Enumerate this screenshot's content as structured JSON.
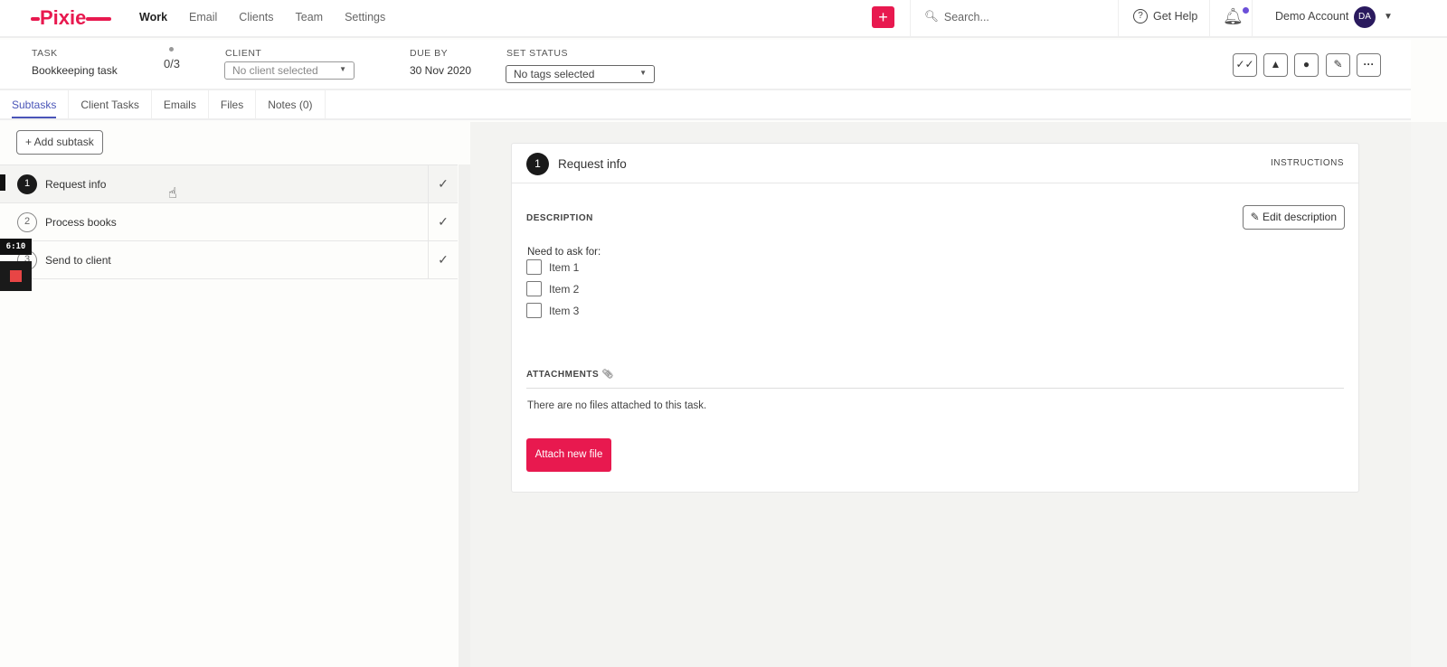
{
  "app": {
    "logo": "Pixie",
    "nav": [
      "Work",
      "Email",
      "Clients",
      "Team",
      "Settings"
    ],
    "search_placeholder": "Search...",
    "help": "Get Help",
    "account": "Demo Account",
    "avatar": "DA",
    "accent": "#e8194f"
  },
  "task": {
    "task_label": "TASK",
    "task_name": "Bookkeeping task",
    "progress": "0/3",
    "client_label": "CLIENT",
    "client_value": "No client selected",
    "due_label": "DUE BY",
    "due_value": "30 Nov 2020",
    "status_label": "SET STATUS",
    "status_value": "No tags selected",
    "toolbar_icons": [
      "double-check-icon",
      "bell-icon",
      "assign-user-icon",
      "pencil-icon",
      "more-icon"
    ]
  },
  "tabs": [
    "Subtasks",
    "Client Tasks",
    "Emails",
    "Files",
    "Notes (0)"
  ],
  "subtasks": {
    "add_label": "+ Add subtask",
    "items": [
      {
        "num": "1",
        "name": "Request info"
      },
      {
        "num": "2",
        "name": "Process books"
      },
      {
        "num": "3",
        "name": "Send to client"
      }
    ]
  },
  "recorder": {
    "time": "6:10"
  },
  "detail": {
    "num": "1",
    "title": "Request info",
    "instructions": "INSTRUCTIONS",
    "description_label": "DESCRIPTION",
    "edit_label": "Edit description",
    "need": "Need to ask for:",
    "items": [
      "Item 1",
      "Item 2",
      "Item 3"
    ],
    "attachments_label": "ATTACHMENTS",
    "no_files": "There are no files attached to this task.",
    "attach_label": "Attach new file"
  }
}
